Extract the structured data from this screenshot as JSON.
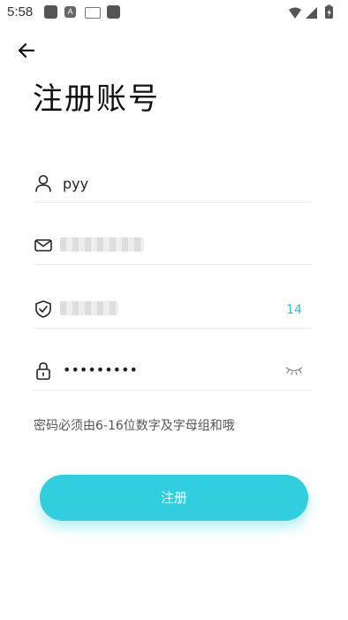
{
  "status_bar": {
    "time": "5:58",
    "notification_icons": [
      "app-icon",
      "font-icon",
      "keyboard-icon",
      "app-icon"
    ],
    "system_icons": [
      "wifi-icon",
      "signal-icon",
      "battery-charging-icon"
    ],
    "font_badge": "A"
  },
  "header": {
    "title": "注册账号",
    "back_icon": "arrow-left-icon"
  },
  "form": {
    "username": {
      "icon": "user-icon",
      "value": "pyy"
    },
    "email": {
      "icon": "mail-icon",
      "value": ""
    },
    "code": {
      "icon": "shield-check-icon",
      "value": "",
      "countdown": "14"
    },
    "password": {
      "icon": "lock-icon",
      "value": "•••••••••",
      "toggle_icon": "eye-closed-icon"
    }
  },
  "hint": "密码必须由6-16位数字及字母组和哦",
  "submit_label": "注册",
  "colors": {
    "accent": "#31cee0",
    "countdown": "#39b7d6"
  }
}
